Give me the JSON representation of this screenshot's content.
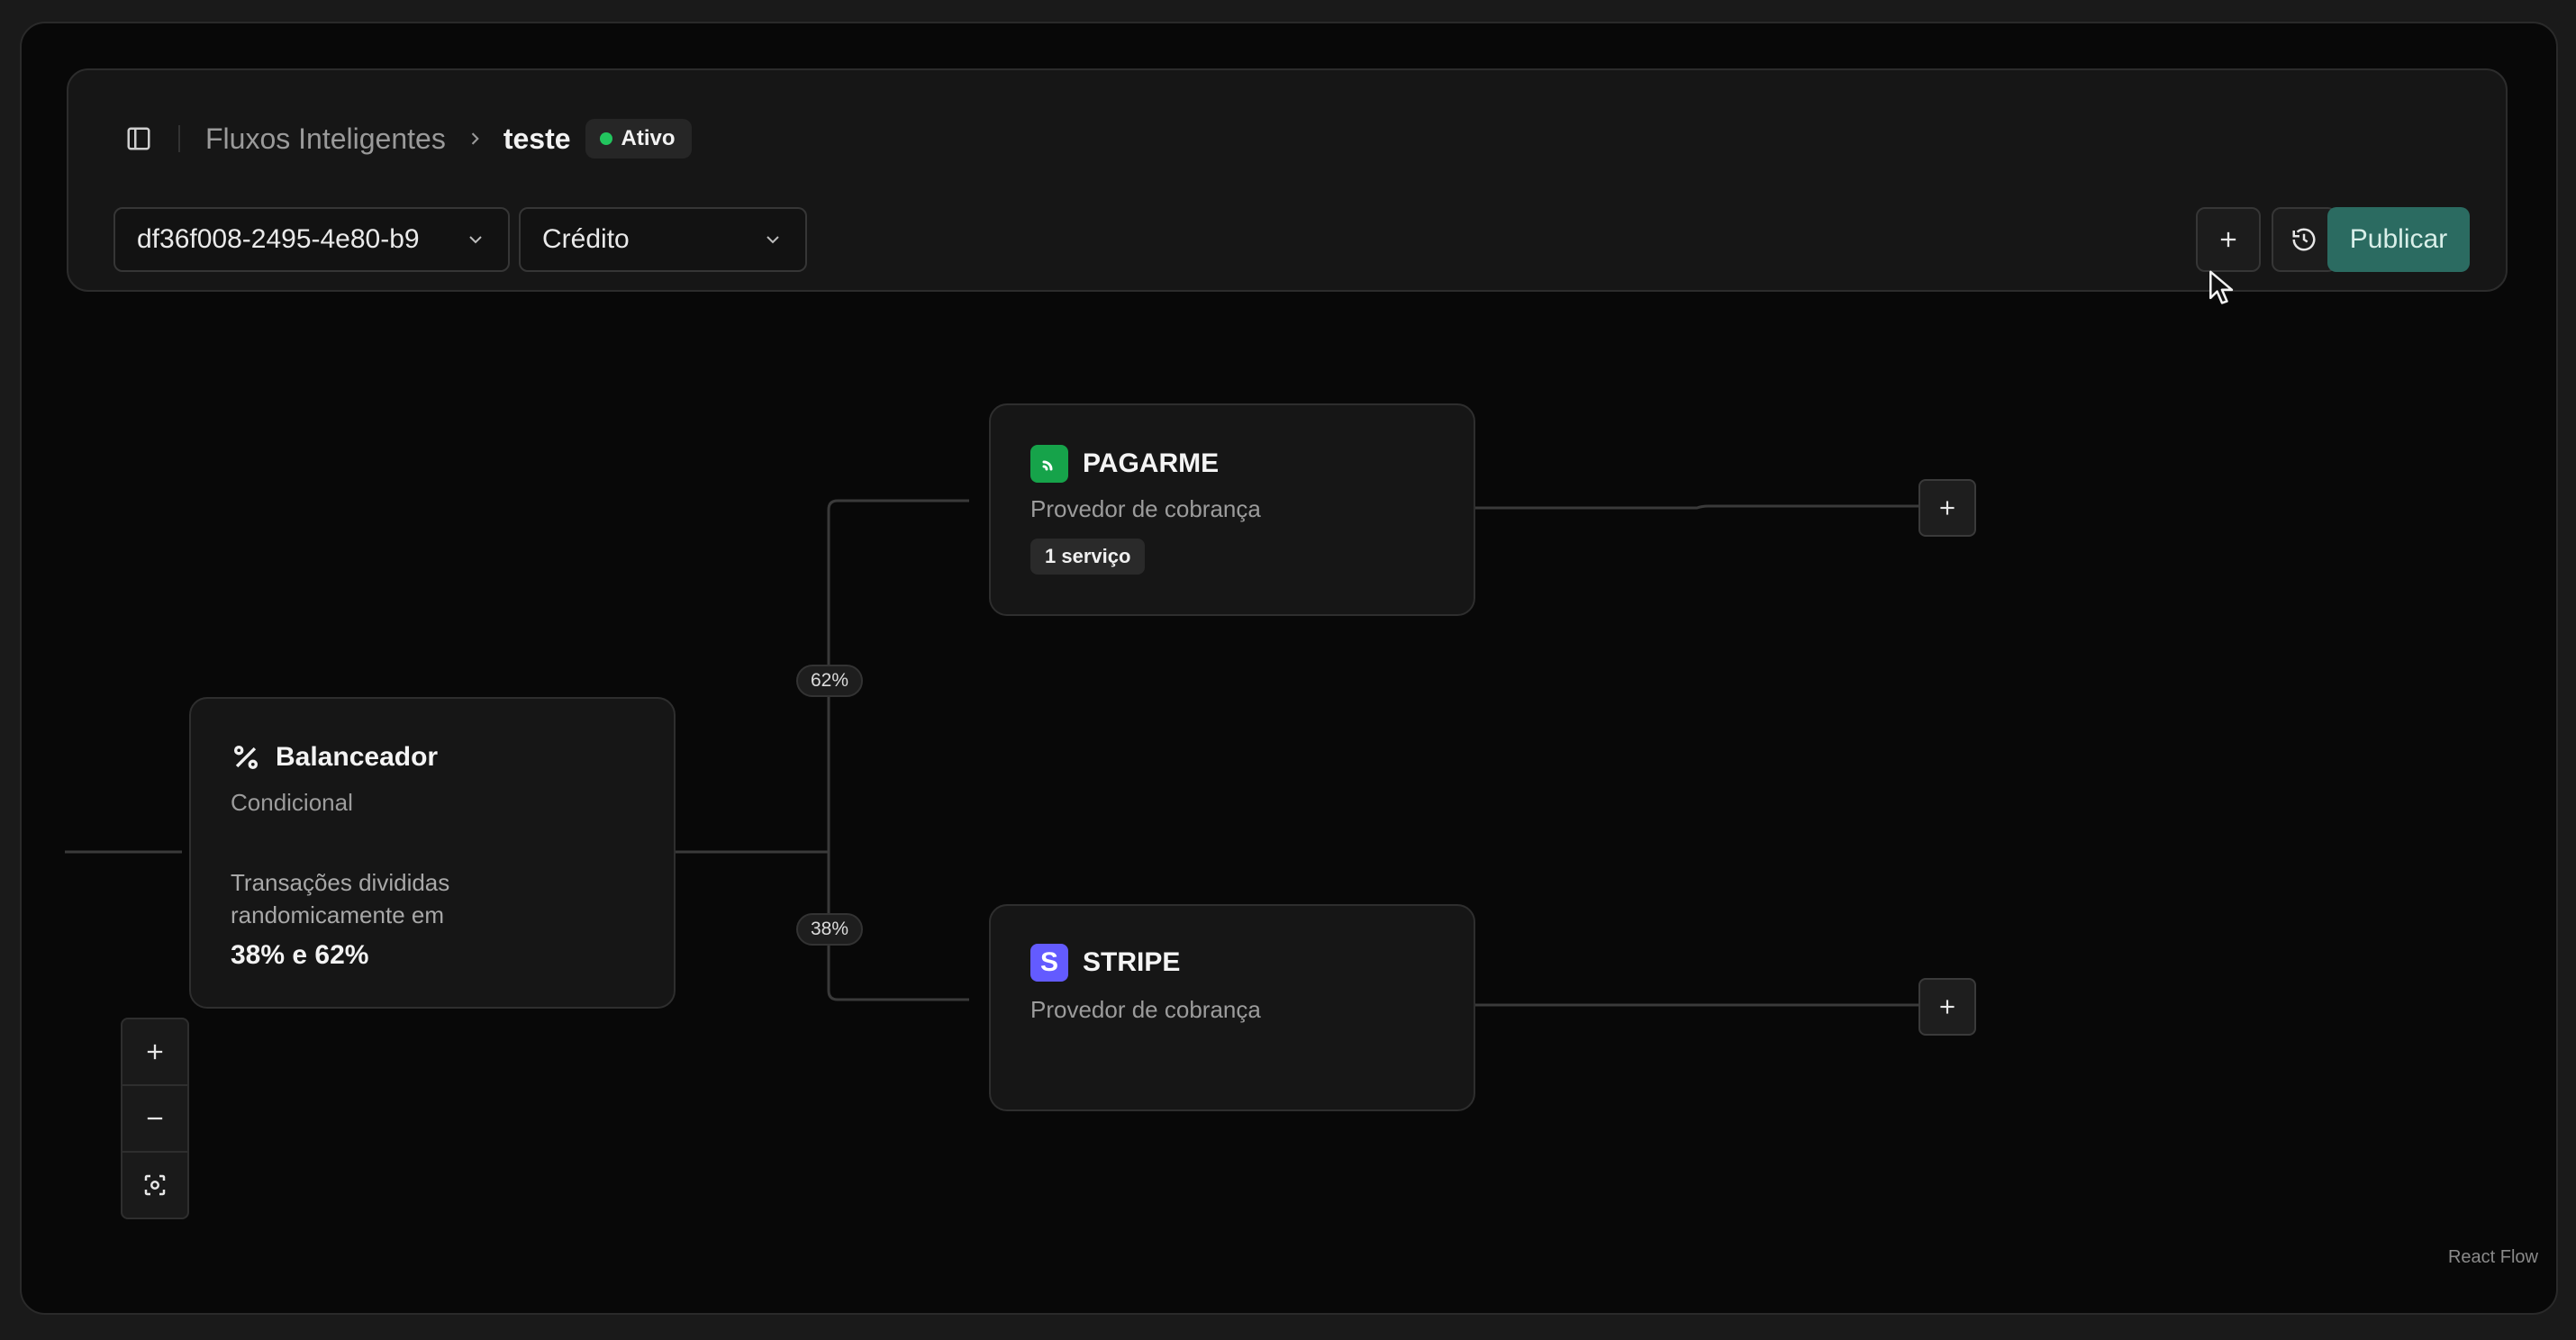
{
  "breadcrumb": {
    "parent": "Fluxos Inteligentes",
    "current": "teste",
    "status": "Ativo",
    "status_color": "#22c55e"
  },
  "toolbar": {
    "flow_id_select": "df36f008-2495-4e80-b9",
    "payment_method_select": "Crédito",
    "publish_label": "Publicar",
    "accent_color": "#2b6b61"
  },
  "nodes": {
    "balancer": {
      "icon": "percent-icon",
      "title": "Balanceador",
      "subtitle": "Condicional",
      "description": "Transações divididas randomicamente em",
      "split": "38% e 62%"
    },
    "pagarme": {
      "icon": "pagarme-logo-icon",
      "title": "PAGARME",
      "subtitle": "Provedor de cobrança",
      "badge": "1 serviço",
      "brand_color": "#16a34a"
    },
    "stripe": {
      "icon": "stripe-logo-icon",
      "title": "STRIPE",
      "subtitle": "Provedor de cobrança",
      "brand_color": "#635bff",
      "logo_letter": "S"
    }
  },
  "edges": {
    "top_percent": "62%",
    "bottom_percent": "38%"
  },
  "canvas": {
    "attribution": "React Flow"
  }
}
